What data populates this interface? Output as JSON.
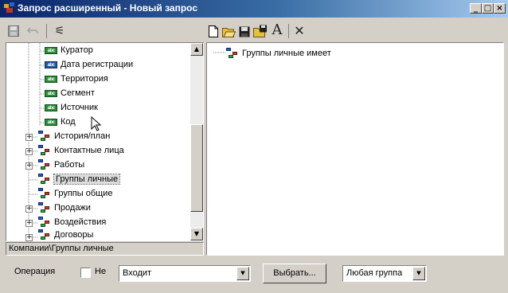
{
  "window": {
    "title": "Запрос расширенный - Новый запрос",
    "min_label": "_",
    "max_label": "□",
    "close_label": "×"
  },
  "left_toolbar": {
    "filter_label": "⚟"
  },
  "right_toolbar": {
    "text_label": "A",
    "delete_label": "✕"
  },
  "tree": {
    "items": [
      {
        "label": "Куратор",
        "kind": "field"
      },
      {
        "label": "Дата регистрации",
        "kind": "field"
      },
      {
        "label": "Территория",
        "kind": "field"
      },
      {
        "label": "Сегмент",
        "kind": "field"
      },
      {
        "label": "Источник",
        "kind": "field"
      },
      {
        "label": "Код",
        "kind": "field"
      },
      {
        "label": "История/план",
        "kind": "group",
        "expandable": true
      },
      {
        "label": "Контактные лица",
        "kind": "group",
        "expandable": true
      },
      {
        "label": "Работы",
        "kind": "group",
        "expandable": true
      },
      {
        "label": "Группы личные",
        "kind": "group",
        "expandable": false,
        "selected": true
      },
      {
        "label": "Группы общие",
        "kind": "group",
        "expandable": false
      },
      {
        "label": "Продажи",
        "kind": "group",
        "expandable": true
      },
      {
        "label": "Воздействия",
        "kind": "group",
        "expandable": true
      },
      {
        "label": "Договоры",
        "kind": "group",
        "expandable": true
      }
    ],
    "field_icon_text": "abc"
  },
  "status_path": "Компании\\Группы личные",
  "query": {
    "root_label": "Группы личные имеет"
  },
  "bottom": {
    "operation_label": "Операция",
    "not_label": "Не",
    "condition_value": "Входит",
    "choose_button": "Выбрать...",
    "group_value": "Любая группа"
  }
}
